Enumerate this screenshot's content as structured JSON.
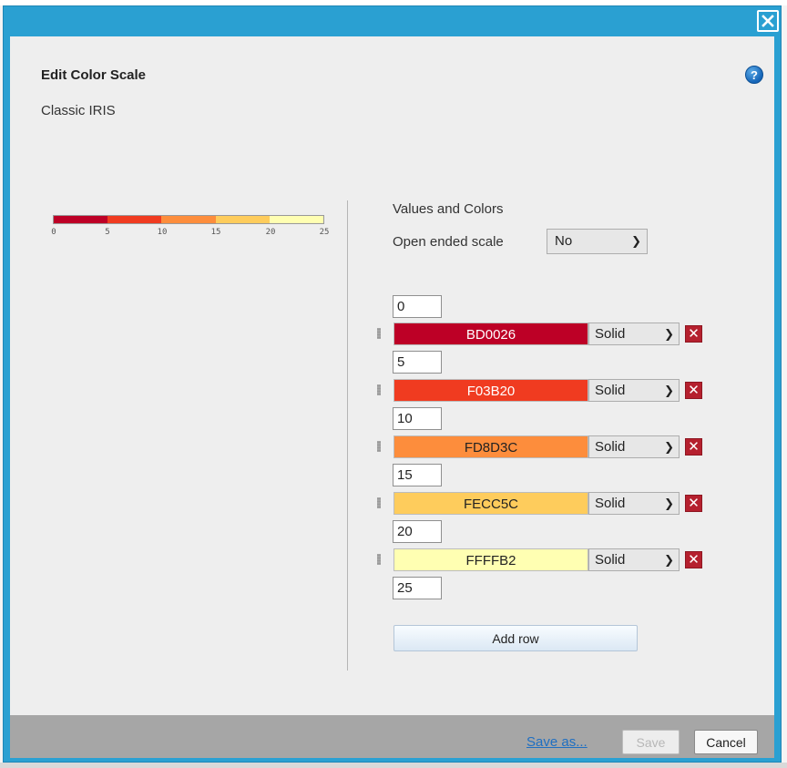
{
  "dialog": {
    "close_icon": "close-icon",
    "heading": "Edit Color Scale",
    "help_icon": "help-icon",
    "help_glyph": "?",
    "scale_name": "Classic IRIS"
  },
  "preview": {
    "colors": [
      "#BD0026",
      "#F03B20",
      "#FD8D3C",
      "#FECC5C",
      "#FFFFB2"
    ],
    "ticks": [
      "0",
      "5",
      "10",
      "15",
      "20",
      "25"
    ]
  },
  "values_section": {
    "title": "Values and Colors",
    "open_ended_label": "Open ended scale",
    "open_ended_value": "No"
  },
  "values": [
    "0",
    "5",
    "10",
    "15",
    "20",
    "25"
  ],
  "color_rows": [
    {
      "hex": "BD0026",
      "color": "#BD0026",
      "text_color": "#ffffff",
      "fill": "Solid"
    },
    {
      "hex": "F03B20",
      "color": "#F03B20",
      "text_color": "#ffffff",
      "fill": "Solid"
    },
    {
      "hex": "FD8D3C",
      "color": "#FD8D3C",
      "text_color": "#222222",
      "fill": "Solid"
    },
    {
      "hex": "FECC5C",
      "color": "#FECC5C",
      "text_color": "#222222",
      "fill": "Solid"
    },
    {
      "hex": "FFFFB2",
      "color": "#FFFFB2",
      "text_color": "#222222",
      "fill": "Solid"
    }
  ],
  "add_row_label": "Add row",
  "footer": {
    "save_as_label": "Save as...",
    "save_label": "Save",
    "cancel_label": "Cancel"
  },
  "colors": {
    "title_bar": "#2aa0d2",
    "delete_button": "#b5202e"
  }
}
